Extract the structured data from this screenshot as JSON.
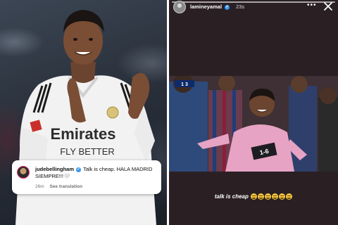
{
  "left_post": {
    "comment": {
      "username": "judebellingham",
      "verified_mark": "✔",
      "text": "Talk is cheap. HALA MADRID SIEMPRE!!!🤍",
      "time": "26m",
      "see_translation": "See translation"
    },
    "jersey": {
      "sponsor_line1": "Emirates",
      "sponsor_line2": "FLY BETTER"
    }
  },
  "story": {
    "username": "lamineyamal",
    "verified_mark": "✔",
    "time_ago": "23s",
    "more_label": "•••",
    "caption": "talk is cheap",
    "emoji_count": 6,
    "photo": {
      "scoreboard": "1 3",
      "sign_text": "1-6"
    }
  },
  "colors": {
    "verified": "#3897f0",
    "story_bg": "#2a2024",
    "card_bg": "#ffffff"
  }
}
